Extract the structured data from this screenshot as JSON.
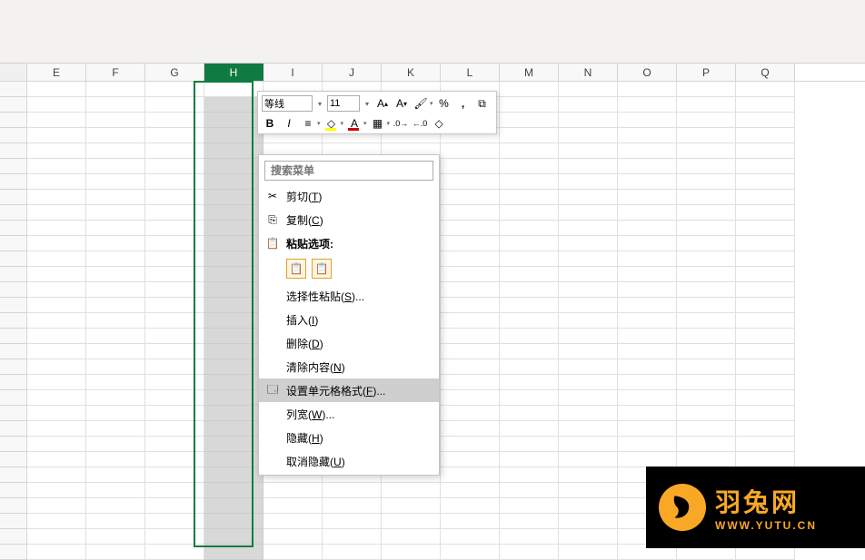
{
  "columns": [
    "E",
    "F",
    "G",
    "H",
    "I",
    "J",
    "K",
    "L",
    "M",
    "N",
    "O",
    "P",
    "Q"
  ],
  "selected_column_index": 3,
  "mini_toolbar": {
    "font_name": "等线",
    "font_size": "11",
    "bold": "B",
    "italic": "I",
    "fill": "◇",
    "fontcolor": "A",
    "increase_font": "A",
    "decrease_font": "A",
    "format_painter": "✎",
    "percent": "%",
    "comma": ",",
    "merge": "▦",
    "border": "▦",
    "align": "≡",
    "inc_dec": ".0",
    "dec_dec": ".00"
  },
  "context_menu": {
    "search_placeholder": "搜索菜单",
    "cut": "剪切",
    "cut_key": "T",
    "copy": "复制",
    "copy_key": "C",
    "paste_options": "粘贴选项:",
    "paste_special": "选择性粘贴",
    "paste_special_key": "S",
    "insert": "插入",
    "insert_key": "I",
    "delete": "删除",
    "delete_key": "D",
    "clear": "清除内容",
    "clear_key": "N",
    "format_cells": "设置单元格格式",
    "format_cells_key": "F",
    "col_width": "列宽",
    "col_width_key": "W",
    "hide": "隐藏",
    "hide_key": "H",
    "unhide": "取消隐藏",
    "unhide_key": "U"
  },
  "watermark": {
    "title": "羽兔网",
    "url": "WWW.YUTU.CN"
  }
}
